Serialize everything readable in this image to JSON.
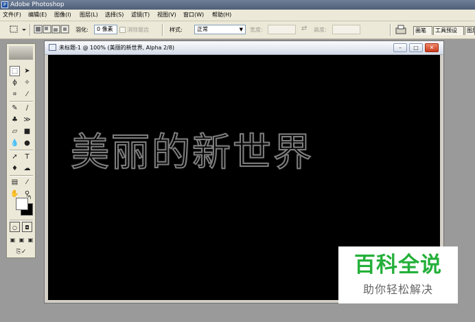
{
  "app": {
    "title": "Adobe Photoshop"
  },
  "menu": [
    {
      "label": "文件(F)"
    },
    {
      "label": "编辑(E)"
    },
    {
      "label": "图像(I)"
    },
    {
      "label": "图层(L)"
    },
    {
      "label": "选择(S)"
    },
    {
      "label": "滤镜(T)"
    },
    {
      "label": "视图(V)"
    },
    {
      "label": "窗口(W)"
    },
    {
      "label": "帮助(H)"
    }
  ],
  "options": {
    "feather_label": "羽化:",
    "feather_value": "0 像素",
    "antialias_label": "消除锯齿",
    "style_label": "样式:",
    "style_value": "正常",
    "width_label": "宽度:",
    "height_label": "高度:",
    "swap_glyph": "⇄"
  },
  "palette_tabs": [
    {
      "label": "画笔"
    },
    {
      "label": "工具预设"
    },
    {
      "label": "图层"
    }
  ],
  "document": {
    "title": "未标题-1 @ 100% (美丽的新世界, Alpha 2/8)",
    "canvas_text": "美丽的新世界"
  },
  "watermark": {
    "title": "百科全说",
    "subtitle": "助你轻松解决"
  },
  "toolbox": {
    "icons": [
      "marquee-icon",
      "move-icon",
      "lasso-icon",
      "magic-wand-icon",
      "crop-icon",
      "slice-icon",
      "healing-brush-icon",
      "brush-icon",
      "clone-stamp-icon",
      "history-brush-icon",
      "eraser-icon",
      "gradient-icon",
      "blur-icon",
      "dodge-icon",
      "path-select-icon",
      "type-icon",
      "pen-icon",
      "shape-icon",
      "notes-icon",
      "eyedropper-icon",
      "hand-icon",
      "zoom-icon"
    ]
  },
  "colors": {
    "accent_green": "#24b03a",
    "canvas_bg": "#000000",
    "title_bar": "#5a6a84"
  }
}
